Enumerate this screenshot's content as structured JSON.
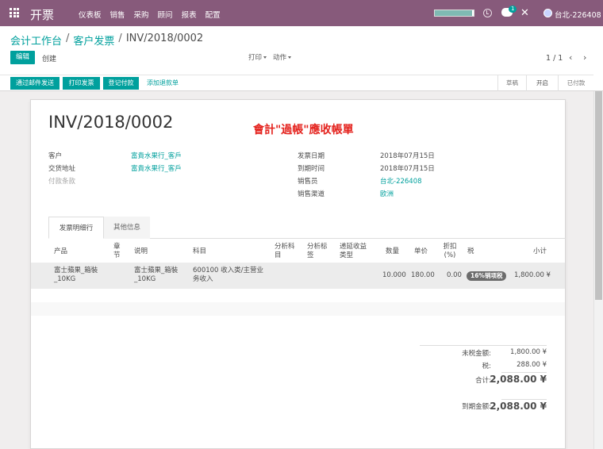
{
  "navbar": {
    "app_name": "开票",
    "menu": [
      "仪表板",
      "销售",
      "采购",
      "顾问",
      "报表",
      "配置"
    ],
    "chat_badge": "1",
    "user_name": "台北-226408",
    "progress": 0.95
  },
  "breadcrumb": {
    "items": [
      "会计工作台",
      "客户发票",
      "INV/2018/0002"
    ],
    "separator": "/"
  },
  "toolbar": {
    "edit_label": "编辑",
    "create_label": "创建",
    "print_label": "打印",
    "action_label": "动作",
    "pager_value": "1 / 1",
    "prev_glyph": "‹",
    "next_glyph": "›"
  },
  "statusbar": {
    "buttons": [
      "通过邮件发送",
      "打印发票",
      "登记付款"
    ],
    "link_button": "添加退款单",
    "stages": [
      "草稿",
      "开启",
      "已付款"
    ],
    "active_stage": "开启"
  },
  "invoice": {
    "number": "INV/2018/0002",
    "note": "會計\"過帳\"應收帳單",
    "left_fields": [
      {
        "label": "客户",
        "value": "富貴水果行_客戶"
      },
      {
        "label": "交货地址",
        "value": "富貴水果行_客戶"
      },
      {
        "label": "付款条款",
        "value": ""
      }
    ],
    "right_fields": [
      {
        "label": "发票日期",
        "value": "2018年07月15日"
      },
      {
        "label": "到期时间",
        "value": "2018年07月15日"
      },
      {
        "label": "销售员",
        "value": "台北-226408"
      },
      {
        "label": "销售渠道",
        "value": "欧洲"
      }
    ]
  },
  "tabs": [
    "发票明细行",
    "其他信息"
  ],
  "table": {
    "headers": [
      "产品",
      "章节",
      "说明",
      "科目",
      "分析科目",
      "分析标签",
      "递延收益类型",
      "数量",
      "单价",
      "折扣(%)",
      "税",
      "小计"
    ],
    "row": {
      "product": "富士蘋果_箱裝_10KG",
      "description": "富士蘋果_箱裝_10KG",
      "account": "600100 收入类/主营业务收入",
      "quantity": "10.000",
      "unit_price": "180.00",
      "discount": "0.00",
      "tax": "16%销项税",
      "subtotal": "1,800.00 ¥"
    }
  },
  "totals": {
    "untaxed_label": "未税金额:",
    "untaxed_value": "1,800.00 ¥",
    "tax_label": "税:",
    "tax_value": "288.00 ¥",
    "total_label": "合计:",
    "total_value": "2,088.00 ¥",
    "due_label": "到期金额:",
    "due_value": "2,088.00 ¥"
  },
  "colors": {
    "brand": "#875a7b",
    "accent": "#00a09d",
    "note_red": "#e4211c"
  }
}
